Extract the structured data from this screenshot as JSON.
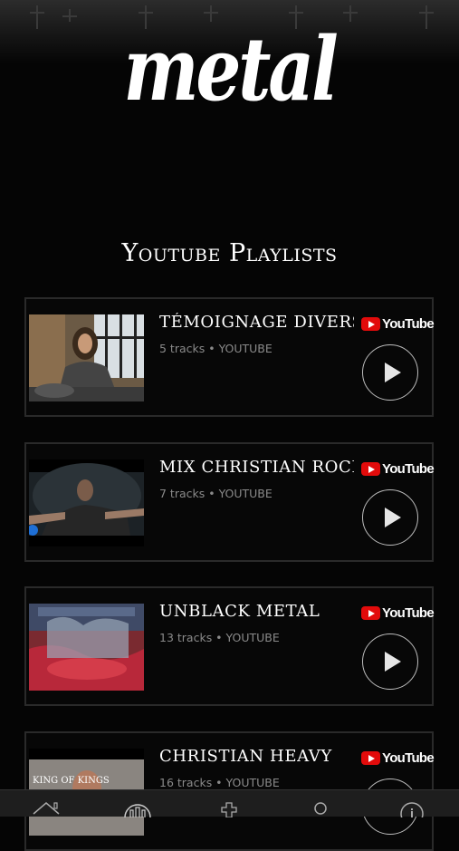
{
  "header": {
    "logo_text": "metal"
  },
  "section": {
    "title": "Youtube Playlists"
  },
  "playlists": [
    {
      "title": "TÉMOIGNAGE DIVERS",
      "meta": "5 tracks • YOUTUBE",
      "source_label": "YouTube"
    },
    {
      "title": "MIX CHRISTIAN ROCK/...",
      "meta": "7 tracks • YOUTUBE",
      "source_label": "YouTube"
    },
    {
      "title": "UNBLACK METAL",
      "meta": "13 tracks • YOUTUBE",
      "source_label": "YouTube"
    },
    {
      "title": "CHRISTIAN HEAVY",
      "meta": "16 tracks • YOUTUBE",
      "source_label": "YouTube"
    }
  ],
  "thumbnail_text": {
    "kings": "KING OF KINGS"
  },
  "tabbar": {
    "tabs": [
      {
        "icon": "home-icon"
      },
      {
        "icon": "app-logo-icon"
      },
      {
        "icon": "cross-icon"
      },
      {
        "icon": "circle-icon"
      },
      {
        "icon": "info-icon"
      }
    ]
  },
  "colors": {
    "background": "#050505",
    "youtube_red": "#e20b0b",
    "meta_text": "#8a8a8a"
  }
}
